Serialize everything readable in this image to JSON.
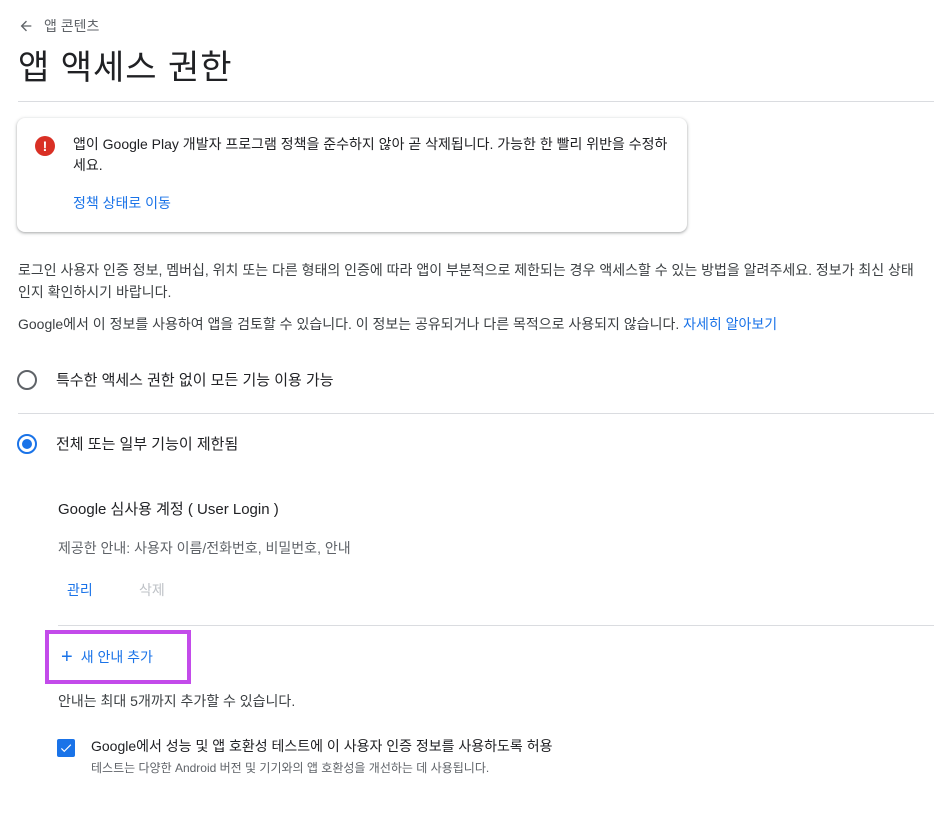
{
  "breadcrumb": {
    "label": "앱 콘텐츠"
  },
  "page": {
    "title": "앱 액세스 권한"
  },
  "alert": {
    "message": "앱이 Google Play 개발자 프로그램 정책을 준수하지 않아 곧 삭제됩니다. 가능한 한 빨리 위반을 수정하세요.",
    "icon_glyph": "!",
    "link": "정책 상태로 이동",
    "color": "#d93025"
  },
  "description": {
    "line1": "로그인 사용자 인증 정보, 멤버십, 위치 또는 다른 형태의 인증에 따라 앱이 부분적으로 제한되는 경우 액세스할 수 있는 방법을 알려주세요. 정보가 최신 상태인지 확인하시기 바랍니다.",
    "line2": "Google에서 이 정보를 사용하여 앱을 검토할 수 있습니다. 이 정보는 공유되거나 다른 목적으로 사용되지 않습니다.",
    "learn_more": "자세히 알아보기"
  },
  "options": [
    {
      "label": "특수한 액세스 권한 없이 모든 기능 이용 가능",
      "selected": false
    },
    {
      "label": "전체 또는 일부 기능이 제한됨",
      "selected": true
    }
  ],
  "instruction": {
    "title": "Google 심사용 계정 ( User Login )",
    "info": "제공한 안내: 사용자 이름/전화번호, 비밀번호, 안내",
    "manage": "관리",
    "delete": "삭제"
  },
  "add_button": {
    "plus": "+",
    "label": "새 안내 추가"
  },
  "limit_note": "안내는 최대 5개까지 추가할 수 있습니다.",
  "consent": {
    "checked": true,
    "label": "Google에서 성능 및 앱 호환성 테스트에 이 사용자 인증 정보를 사용하도록 허용",
    "sub": "테스트는 다양한 Android 버전 및 기기와의 앱 호환성을 개선하는 데 사용됩니다."
  },
  "colors": {
    "accent": "#1a73e8",
    "highlight": "#c34bea"
  }
}
